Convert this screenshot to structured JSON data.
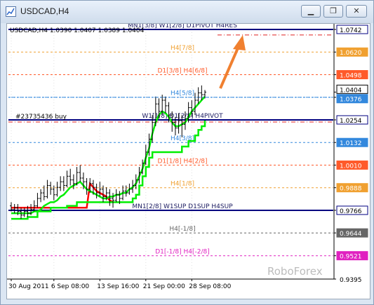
{
  "window": {
    "title": "USDCAD,H4",
    "minimize_glyph": "▁",
    "restore_glyph": "❐",
    "close_glyph": "✕",
    "icon": "chart-window-icon"
  },
  "chart_data": {
    "type": "line",
    "symbol_info": "USDCAD,H4  1.0390 1.0407 1.0389 1.0404",
    "watermark": "RoboForex",
    "order_label": "#23735436 buy",
    "ylim": [
      0.9395,
      1.0742
    ],
    "x_ticks": [
      "30 Aug 2011",
      "6 Sep 08:00",
      "13 Sep 16:00",
      "21 Sep 00:00",
      "28 Sep 08:00"
    ],
    "y_ticks": [
      "1.0742",
      "1.0620",
      "1.0498",
      "1.0404",
      "1.0376",
      "1.0254",
      "1.0132",
      "1.0010",
      "0.9888",
      "0.9766",
      "0.9644",
      "0.9521",
      "0.9395"
    ],
    "current_price": 1.0404,
    "levels": [
      {
        "value": 1.0742,
        "label": "MN1[3/8] W1[2/8] D1PIVOT H4RES",
        "color": "#000080",
        "style": "solid",
        "tag": "1.0742",
        "tag_bg": "#ffffff",
        "tag_fg": "#000000"
      },
      {
        "value": 1.062,
        "label": "H4[7/8]",
        "color": "#f0a030",
        "style": "dash",
        "tag": "1.0620",
        "tag_bg": "#f0a030",
        "tag_fg": "#ffffff"
      },
      {
        "value": 1.0498,
        "label": "D1[3/8] H4[6/8]",
        "color": "#ff5a2a",
        "style": "dash",
        "tag": "1.0498",
        "tag_bg": "#ff5a2a",
        "tag_fg": "#ffffff"
      },
      {
        "value": 1.0376,
        "label": "H4[5/8]",
        "color": "#3388dd",
        "style": "dash",
        "tag": "1.0376",
        "tag_bg": "#3388dd",
        "tag_fg": "#ffffff"
      },
      {
        "value": 1.0254,
        "label": "W1[1/8] D1[2/8] H4PIVOT",
        "color": "#000080",
        "style": "solid",
        "tag": "1.0254",
        "tag_bg": "#ffffff",
        "tag_fg": "#000000"
      },
      {
        "value": 1.0132,
        "label": "H4[3/8]",
        "color": "#3388dd",
        "style": "dash",
        "tag": "1.0132",
        "tag_bg": "#3388dd",
        "tag_fg": "#ffffff"
      },
      {
        "value": 1.001,
        "label": "D1[1/8] H4[2/8]",
        "color": "#ff5a2a",
        "style": "dash",
        "tag": "1.0010",
        "tag_bg": "#ff5a2a",
        "tag_fg": "#ffffff"
      },
      {
        "value": 0.9888,
        "label": "H4[1/8]",
        "color": "#f0a030",
        "style": "dash",
        "tag": "0.9888",
        "tag_bg": "#f0a030",
        "tag_fg": "#ffffff"
      },
      {
        "value": 0.9766,
        "label": "MN1[2/8] W1SUP D1SUP H4SUP",
        "color": "#000080",
        "style": "solid",
        "tag": "0.9766",
        "tag_bg": "#ffffff",
        "tag_fg": "#000000"
      },
      {
        "value": 0.9644,
        "label": "H4[-1/8]",
        "color": "#666666",
        "style": "dash",
        "tag": "0.9644",
        "tag_bg": "#666666",
        "tag_fg": "#ffffff"
      },
      {
        "value": 0.9521,
        "label": "D1[-1/8] H4[-2/8]",
        "color": "#e020c0",
        "style": "dash",
        "tag": "0.9521",
        "tag_bg": "#e020c0",
        "tag_fg": "#ffffff"
      }
    ],
    "order_line": {
      "value": 1.0254,
      "color": "#e02020"
    },
    "target_line": {
      "value": 1.0712,
      "color": "#e02020"
    },
    "current_line_value": 1.0376,
    "arrow_color": "#f08030",
    "series": [
      {
        "kind": "ohlc",
        "color": "#000000",
        "bars": [
          [
            0.979,
            0.977,
            0.981,
            0.976
          ],
          [
            0.977,
            0.978,
            0.98,
            0.975
          ],
          [
            0.978,
            0.976,
            0.98,
            0.974
          ],
          [
            0.976,
            0.974,
            0.978,
            0.972
          ],
          [
            0.974,
            0.976,
            0.978,
            0.973
          ],
          [
            0.976,
            0.975,
            0.979,
            0.973
          ],
          [
            0.975,
            0.977,
            0.98,
            0.974
          ],
          [
            0.977,
            0.979,
            0.982,
            0.976
          ],
          [
            0.979,
            0.983,
            0.986,
            0.978
          ],
          [
            0.983,
            0.986,
            0.988,
            0.981
          ],
          [
            0.986,
            0.984,
            0.99,
            0.982
          ],
          [
            0.984,
            0.99,
            0.993,
            0.983
          ],
          [
            0.99,
            0.988,
            0.992,
            0.985
          ],
          [
            0.988,
            0.985,
            0.99,
            0.982
          ],
          [
            0.985,
            0.989,
            0.992,
            0.984
          ],
          [
            0.989,
            0.992,
            0.995,
            0.987
          ],
          [
            0.992,
            0.99,
            0.995,
            0.987
          ],
          [
            0.99,
            0.995,
            0.998,
            0.989
          ],
          [
            0.995,
            0.993,
            0.999,
            0.99
          ],
          [
            0.993,
            0.991,
            0.996,
            0.988
          ],
          [
            0.991,
            0.997,
            1.0,
            0.99
          ],
          [
            0.997,
            0.994,
            1.001,
            0.992
          ],
          [
            0.994,
            0.992,
            0.997,
            0.988
          ],
          [
            0.992,
            0.988,
            0.994,
            0.985
          ],
          [
            0.988,
            0.991,
            0.994,
            0.986
          ],
          [
            0.991,
            0.989,
            0.993,
            0.985
          ],
          [
            0.989,
            0.986,
            0.991,
            0.983
          ],
          [
            0.986,
            0.988,
            0.992,
            0.984
          ],
          [
            0.988,
            0.984,
            0.99,
            0.981
          ],
          [
            0.984,
            0.986,
            0.989,
            0.982
          ],
          [
            0.986,
            0.983,
            0.988,
            0.979
          ],
          [
            0.983,
            0.982,
            0.986,
            0.978
          ],
          [
            0.982,
            0.985,
            0.988,
            0.981
          ],
          [
            0.985,
            0.983,
            0.987,
            0.98
          ],
          [
            0.983,
            0.987,
            0.99,
            0.982
          ],
          [
            0.987,
            0.986,
            0.99,
            0.984
          ],
          [
            0.986,
            0.988,
            0.991,
            0.985
          ],
          [
            0.988,
            0.99,
            0.993,
            0.986
          ],
          [
            0.99,
            0.993,
            0.996,
            0.988
          ],
          [
            0.993,
            0.997,
            1.0,
            0.991
          ],
          [
            0.997,
            1.002,
            1.004,
            0.996
          ],
          [
            1.002,
            1.008,
            1.012,
            1.001
          ],
          [
            1.008,
            1.015,
            1.018,
            1.006
          ],
          [
            1.015,
            1.024,
            1.028,
            1.013
          ],
          [
            1.024,
            1.034,
            1.038,
            1.022
          ],
          [
            1.034,
            1.03,
            1.037,
            1.026
          ],
          [
            1.03,
            1.036,
            1.039,
            1.028
          ],
          [
            1.036,
            1.033,
            1.038,
            1.029
          ],
          [
            1.033,
            1.028,
            1.035,
            1.024
          ],
          [
            1.028,
            1.024,
            1.03,
            1.019
          ],
          [
            1.024,
            1.021,
            1.027,
            1.017
          ],
          [
            1.021,
            1.025,
            1.029,
            1.018
          ],
          [
            1.025,
            1.023,
            1.028,
            1.016
          ],
          [
            1.023,
            1.026,
            1.03,
            1.02
          ],
          [
            1.026,
            1.032,
            1.035,
            1.024
          ],
          [
            1.032,
            1.03,
            1.036,
            1.027
          ],
          [
            1.03,
            1.036,
            1.04,
            1.028
          ],
          [
            1.036,
            1.04,
            1.043,
            1.034
          ],
          [
            1.04,
            1.039,
            1.044,
            1.036
          ],
          [
            1.039,
            1.0404,
            1.0415,
            1.037
          ]
        ]
      },
      {
        "kind": "line",
        "name": "",
        "color": "#ff0000",
        "values": [
          0.978,
          0.978,
          0.978,
          0.978,
          0.978,
          0.978,
          0.978,
          0.978,
          0.978,
          0.978,
          0.978,
          0.978,
          0.978,
          0.978,
          0.978,
          0.978,
          0.978,
          0.978,
          0.978,
          0.978,
          0.978,
          0.978,
          0.978,
          0.978,
          0.991,
          0.989,
          0.987,
          0.986,
          0.985,
          0.984,
          0.982,
          0.981,
          null,
          null,
          null,
          null,
          null,
          null,
          null,
          null,
          null,
          null,
          null,
          null,
          null,
          null,
          null,
          null,
          null,
          null,
          null,
          null,
          null,
          null,
          null,
          null,
          null,
          null,
          null,
          null
        ]
      },
      {
        "kind": "line",
        "name": "",
        "color": "#00ee00",
        "values": [
          0.975,
          0.975,
          0.975,
          0.975,
          0.975,
          0.975,
          0.975,
          0.976,
          0.976,
          0.977,
          0.979,
          0.98,
          0.981,
          0.981,
          0.982,
          0.984,
          0.985,
          0.987,
          0.989,
          0.99,
          0.991,
          0.992,
          0.99,
          0.988,
          0.987,
          0.986,
          0.985,
          0.984,
          0.983,
          0.983,
          0.984,
          0.984,
          0.985,
          0.985,
          0.986,
          0.986,
          0.988,
          0.989,
          0.991,
          0.995,
          0.999,
          1.005,
          1.01,
          1.018,
          1.024,
          1.028,
          1.03,
          1.029,
          1.027,
          1.024,
          1.022,
          1.022,
          1.023,
          1.024,
          1.027,
          1.03,
          1.032,
          1.034,
          1.036,
          1.038
        ]
      },
      {
        "kind": "line",
        "name": "",
        "color": "#00ee00",
        "step": true,
        "values": [
          0.972,
          0.972,
          0.972,
          0.972,
          0.972,
          0.973,
          0.973,
          0.973,
          0.976,
          0.976,
          0.976,
          0.976,
          0.978,
          0.978,
          0.978,
          0.978,
          0.978,
          0.979,
          0.979,
          0.979,
          0.981,
          0.981,
          0.981,
          0.981,
          0.981,
          0.981,
          0.981,
          0.981,
          0.981,
          0.981,
          0.981,
          0.981,
          0.981,
          0.981,
          0.981,
          0.981,
          0.981,
          0.983,
          0.985,
          0.99,
          0.995,
          1.0,
          1.005,
          1.008,
          1.008,
          1.008,
          1.008,
          1.008,
          1.008,
          1.008,
          1.008,
          1.008,
          1.011,
          1.011,
          1.014,
          1.014,
          1.017,
          1.02,
          1.022,
          1.025
        ]
      }
    ]
  }
}
